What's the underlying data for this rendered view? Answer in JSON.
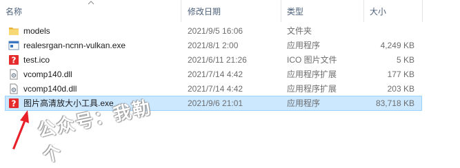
{
  "columns": {
    "name": "名称",
    "date": "修改日期",
    "type": "类型",
    "size": "大小"
  },
  "files": [
    {
      "name": "models",
      "date": "2021/9/5 16:06",
      "type": "文件夹",
      "size": "",
      "icon": "folder-icon"
    },
    {
      "name": "realesrgan-ncnn-vulkan.exe",
      "date": "2021/8/1 2:00",
      "type": "应用程序",
      "size": "4,249 KB",
      "icon": "exe-icon"
    },
    {
      "name": "test.ico",
      "date": "2021/6/11 21:26",
      "type": "ICO 图片文件",
      "size": "5 KB",
      "icon": "question-icon"
    },
    {
      "name": "vcomp140.dll",
      "date": "2021/7/14 4:42",
      "type": "应用程序扩展",
      "size": "177 KB",
      "icon": "dll-icon"
    },
    {
      "name": "vcomp140d.dll",
      "date": "2021/7/14 4:42",
      "type": "应用程序扩展",
      "size": "203 KB",
      "icon": "dll-icon"
    },
    {
      "name": "图片高清放大小工具.exe",
      "date": "2021/9/6 21:01",
      "type": "应用程序",
      "size": "83,718 KB",
      "icon": "question-icon",
      "selected": true
    }
  ],
  "watermark": "公众号：我勒个",
  "colors": {
    "header_text": "#4c607a",
    "selection_bg": "#cce8ff",
    "selection_border": "#99d1ff",
    "arrow": "#e8202a",
    "folder": "#f5c542",
    "question": "#e52b2b"
  }
}
